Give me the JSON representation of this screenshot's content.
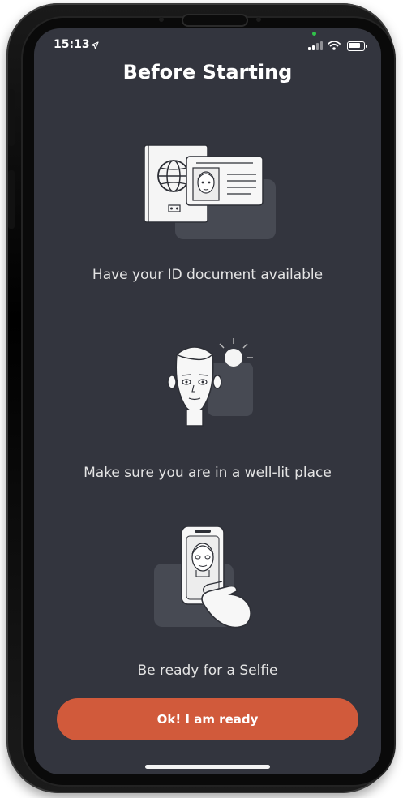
{
  "status_bar": {
    "time": "15:13",
    "location_icon": "location-arrow-icon",
    "signal_icon": "cellular-signal-icon",
    "wifi_icon": "wifi-icon",
    "battery_icon": "battery-icon"
  },
  "page": {
    "title": "Before Starting"
  },
  "steps": [
    {
      "icon": "id-document-icon",
      "caption": "Have your ID document available"
    },
    {
      "icon": "face-light-icon",
      "caption": "Make sure you are in a well-lit place"
    },
    {
      "icon": "selfie-phone-icon",
      "caption": "Be ready for a Selfie"
    }
  ],
  "actions": {
    "ready_label": "Ok! I am ready"
  },
  "colors": {
    "background": "#33353e",
    "accent": "#d15a3b",
    "text": "#ffffff"
  }
}
